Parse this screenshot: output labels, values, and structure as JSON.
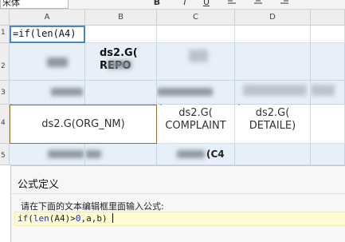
{
  "toolbar": {
    "font_name": "宋体",
    "bold_label": "B",
    "italic_label": "I",
    "underline_label": "U",
    "align_left_icon": "align-left-icon",
    "align_center_icon": "align-center-icon",
    "align_right_icon": "align-right-icon"
  },
  "grid": {
    "columns": [
      "A",
      "B",
      "C",
      "D"
    ],
    "rows": [
      "1",
      "2",
      "3",
      "4",
      "5"
    ],
    "cells": {
      "A1": "=if(len(A4)",
      "B2_line1": "ds2.G(",
      "B2_line2": "REPO",
      "A4": "ds2.G(ORG_NM)",
      "C4_line1": "ds2.G(",
      "C4_line2": "COMPLAINT",
      "D4_line1": "ds2.G(",
      "D4_line2": "DETAILE)",
      "C5_fragment": "(C4"
    }
  },
  "dialog": {
    "title": "公式定义",
    "prompt": "请在下面的文本编辑框里面输入公式:",
    "formula": {
      "fn": "if",
      "open": "(",
      "inner_fn": "len",
      "arg": "(A4)",
      "op": ">",
      "num": "0",
      "rest": ",a,b)"
    }
  },
  "colors": {
    "selected_cell_border": "#4a86c8",
    "active_cell_border": "#9a6f2d",
    "band_fill": "#e7eff8",
    "editor_bg": "#fffbd2",
    "keyword": "#1a2fd0"
  }
}
